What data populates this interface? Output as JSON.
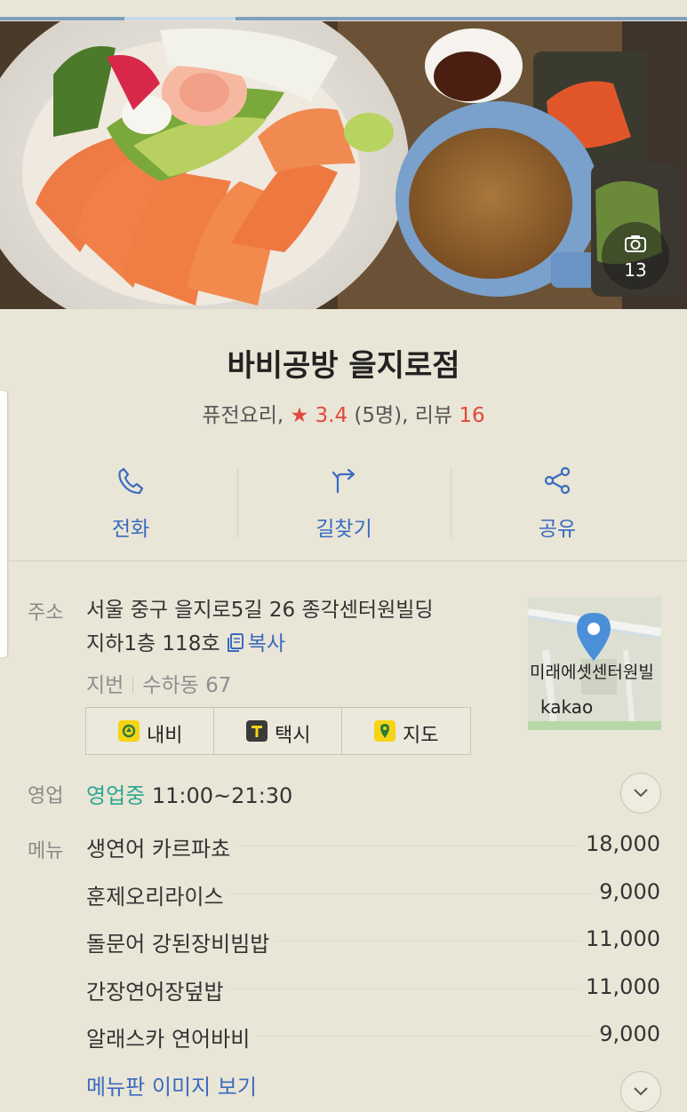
{
  "place": {
    "name": "바비공방 을지로점",
    "category": "퓨전요리,",
    "rating": "3.4",
    "rating_count": "(5명),",
    "review_label": "리뷰",
    "review_count": "16",
    "photo_count": "13"
  },
  "actions": [
    {
      "label": "전화",
      "icon": "phone-icon"
    },
    {
      "label": "길찾기",
      "icon": "directions-icon"
    },
    {
      "label": "공유",
      "icon": "share-icon"
    }
  ],
  "address": {
    "label": "주소",
    "line1": "서울 중구 을지로5길 26 종각센터원빌딩",
    "line2": "지하1층 118호",
    "copy_label": "복사",
    "jibun_label": "지번",
    "jibun_value": "수하동 67",
    "buttons": [
      {
        "label": "내비",
        "icon": "navi-icon",
        "color": "#f5d416"
      },
      {
        "label": "택시",
        "icon": "taxi-icon",
        "color": "#3a3a3a"
      },
      {
        "label": "지도",
        "icon": "map-pin-icon",
        "color": "#f5d416"
      }
    ],
    "map_text": "미래에셋센터원빌",
    "map_brand": "kakao"
  },
  "hours": {
    "label": "영업",
    "status": "영업중",
    "time": "11:00~21:30"
  },
  "menu": {
    "label": "메뉴",
    "items": [
      {
        "name": "생연어 카르파쵸",
        "price": "18,000"
      },
      {
        "name": "훈제오리라이스",
        "price": "9,000"
      },
      {
        "name": "돌문어 강된장비빔밥",
        "price": "11,000"
      },
      {
        "name": "간장연어장덮밥",
        "price": "11,000"
      },
      {
        "name": "알래스카 연어바비",
        "price": "9,000"
      }
    ],
    "more_label": "메뉴판 이미지 보기"
  },
  "colors": {
    "accent_blue": "#3a6bbf",
    "open_green": "#2ea891",
    "rating_red": "#e04a3a",
    "pin_blue": "#4a8fd8"
  }
}
